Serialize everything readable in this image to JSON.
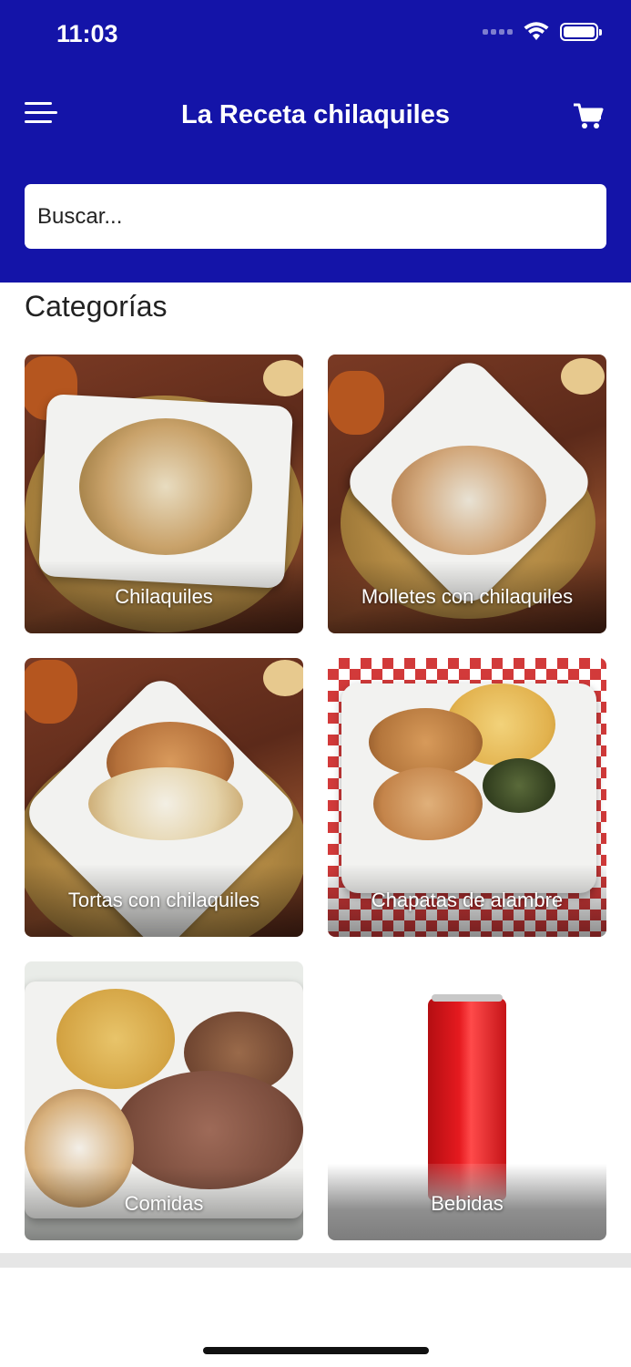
{
  "status": {
    "time": "11:03"
  },
  "header": {
    "title": "La Receta chilaquiles"
  },
  "search": {
    "placeholder": "Buscar..."
  },
  "categories": {
    "heading": "Categorías",
    "items": [
      {
        "label": "Chilaquiles"
      },
      {
        "label": "Molletes con chilaquiles"
      },
      {
        "label": "Tortas con chilaquiles"
      },
      {
        "label": "Chapatas de alambre"
      },
      {
        "label": "Comidas"
      },
      {
        "label": "Bebidas"
      }
    ]
  },
  "colors": {
    "header": "#1414a8",
    "text": "#222222"
  },
  "icons": {
    "menu": "menu-icon",
    "cart": "cart-icon",
    "wifi": "wifi-icon",
    "battery": "battery-icon"
  }
}
